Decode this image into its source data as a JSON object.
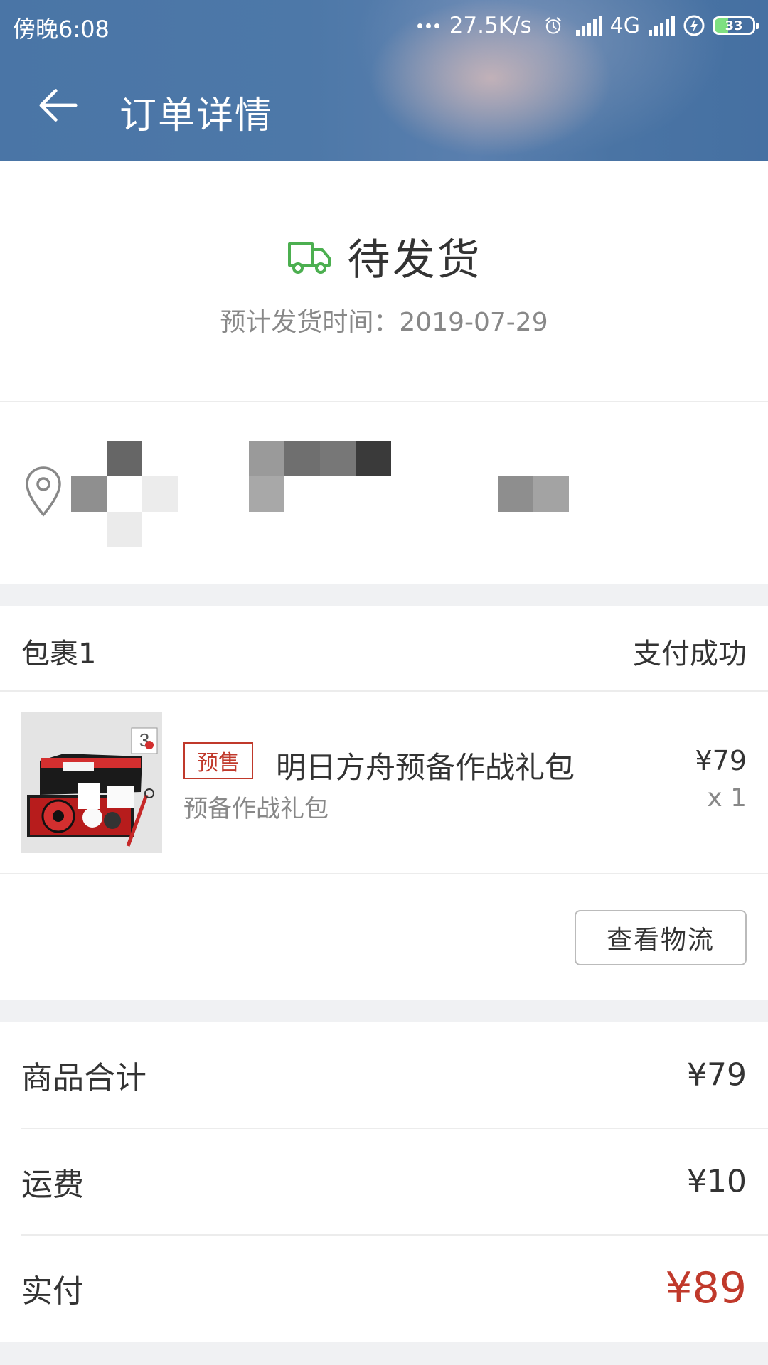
{
  "status_bar": {
    "time": "傍晚6:08",
    "net_speed": "27.5K/s",
    "net_type": "4G",
    "battery": "33"
  },
  "header": {
    "title": "订单详情"
  },
  "order_status": {
    "status": "待发货",
    "eta": "预计发货时间：2019-07-29"
  },
  "package": {
    "name": "包裹1",
    "state": "支付成功",
    "item": {
      "tag": "预售",
      "title": "明日方舟预备作战礼包",
      "subtitle": "预备作战礼包",
      "price": "¥79",
      "quantity": "x 1"
    },
    "logistics_label": "查看物流"
  },
  "summary": {
    "subtotal_label": "商品合计",
    "subtotal": "¥79",
    "shipping_label": "运费",
    "shipping": "¥10",
    "paid_label": "实付",
    "paid": "¥89"
  },
  "colors": {
    "accent_red": "#c0392b",
    "truck_green": "#4caf50",
    "header_blue": "#4a75a6"
  },
  "icons": {
    "back": "arrow-left-icon",
    "truck": "truck-icon",
    "location": "location-pin-icon"
  }
}
